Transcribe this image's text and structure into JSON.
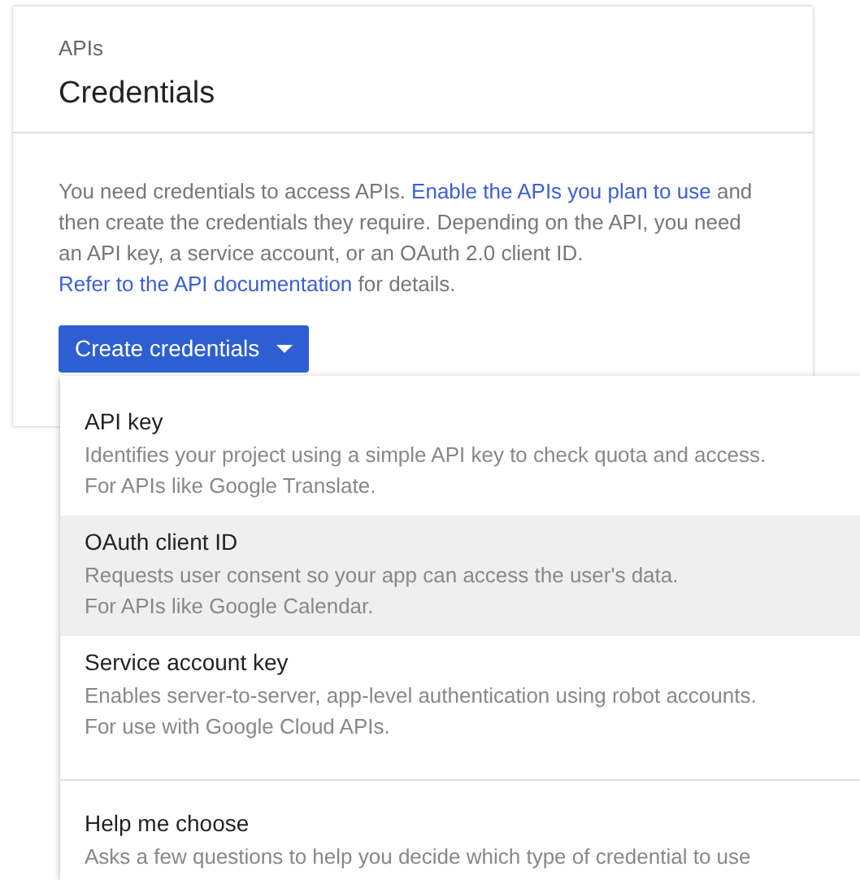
{
  "header": {
    "eyebrow": "APIs",
    "title": "Credentials"
  },
  "intro": [
    {
      "kind": "text",
      "text": "You need credentials to access APIs. "
    },
    {
      "kind": "link",
      "text": "Enable the APIs you plan to use"
    },
    {
      "kind": "text",
      "text": " and then create the credentials they require. Depending on the API, you need an API key, a service account, or an OAuth 2.0 client ID. "
    },
    {
      "kind": "link",
      "text": "Refer to the API documentation"
    },
    {
      "kind": "text",
      "text": " for details."
    }
  ],
  "create_button": {
    "label": "Create credentials",
    "expanded": true
  },
  "menu": [
    {
      "title": "API key",
      "highlighted": false,
      "lines": [
        "Identifies your project using a simple API key to check quota and access.",
        "For APIs like Google Translate."
      ]
    },
    {
      "title": "OAuth client ID",
      "highlighted": true,
      "lines": [
        "Requests user consent so your app can access the user's data.",
        "For APIs like Google Calendar."
      ]
    },
    {
      "title": "Service account key",
      "highlighted": false,
      "lines": [
        "Enables server-to-server, app-level authentication using robot accounts.",
        "For use with Google Cloud APIs."
      ]
    },
    {
      "title": "Help me choose",
      "highlighted": false,
      "divider_before": true,
      "lines": [
        "Asks a few questions to help you decide which type of credential to use"
      ]
    }
  ]
}
